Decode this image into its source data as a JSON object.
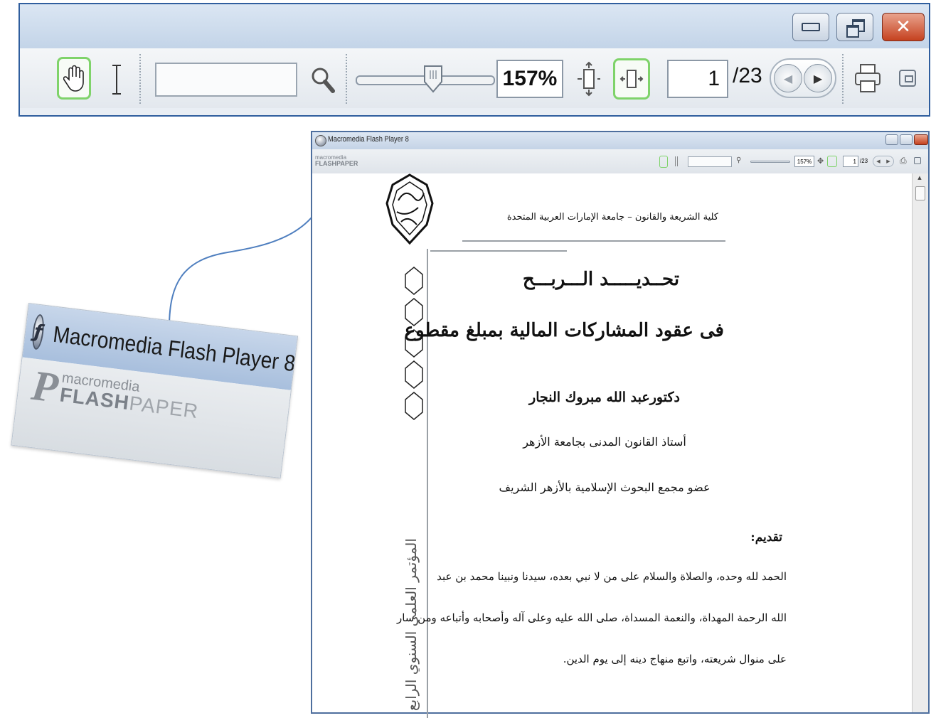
{
  "zoom_toolbar": {
    "zoom_level": "157%",
    "current_page": "1",
    "total_pages": "/23"
  },
  "logo_zoom": {
    "title": "Macromedia Flash Player 8",
    "brand_small": "macromedia",
    "brand_big": "FLASH",
    "brand_big_light": "PAPER"
  },
  "window": {
    "title": "Macromedia Flash Player 8",
    "mini_brand_small": "macromedia",
    "mini_brand_big": "FLASHPAPER",
    "zoom_level": "157%",
    "current_page": "1",
    "total_pages": "/23"
  },
  "document": {
    "header": "كلية الشريعة والقانون – جامعة الإمارات العربية المتحدة",
    "title_line1": "تحــديـــــد الـــربـــح",
    "title_line2": "فى عقود المشاركات المالية بمبلغ مقطوع",
    "author": "دكتورعبد الله مبروك النجار",
    "affiliation1": "أستاذ القانون المدنى بجامعة الأزهر",
    "affiliation2": "عضو مجمع البحوث الإسلامية بالأزهر الشريف",
    "intro_heading": "تقديم:",
    "paragraph": [
      "الحمد لله وحده، والصلاة والسلام على من لا نبي بعده، سيدنا ونبينا محمد بن عبد",
      "الله  الرحمة المهداة، والنعمة المسداة، صلى الله عليه وعلى آله وأصحابه وأتباعه ومن سار",
      "على منوال شريعته، واتبع منهاج دينه إلى يوم الدين."
    ],
    "vertical_banner": "المؤتمر العلمي السنوي الرابع"
  },
  "colors": {
    "frame_blue": "#2f5e9e",
    "active_green": "#7fd36a",
    "close_red": "#c5411f"
  }
}
